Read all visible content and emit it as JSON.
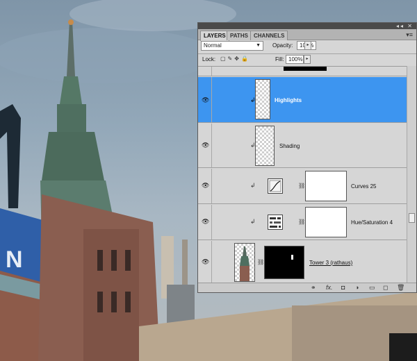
{
  "panel": {
    "tabs": [
      "LAYERS",
      "PATHS",
      "CHANNELS"
    ],
    "active_tab": "LAYERS",
    "blend_mode": "Normal",
    "opacity_label": "Opacity:",
    "opacity_value": "100%",
    "lock_label": "Lock:",
    "fill_label": "Fill:",
    "fill_value": "100%"
  },
  "layers": [
    {
      "name": "Highlights",
      "type": "pixel",
      "selected": true,
      "clipped": true
    },
    {
      "name": "Shading",
      "type": "pixel",
      "selected": false,
      "clipped": true
    },
    {
      "name": "Curves 25",
      "type": "adjustment-curves",
      "selected": false,
      "clipped": true,
      "mask": "white"
    },
    {
      "name": "Hue/Saturation 4",
      "type": "adjustment-hue-saturation",
      "selected": false,
      "clipped": true,
      "mask": "white"
    },
    {
      "name": "Tower 3 (rathaus)",
      "type": "pixel",
      "selected": false,
      "clipped": false,
      "mask": "black",
      "underlined": true
    }
  ],
  "colors": {
    "selection": "#3d95f0",
    "panel_bg": "#d6d6d6"
  },
  "icons": {
    "visibility": "eye-icon",
    "clip": "clipping-arrow-icon",
    "link": "chain-link-icon",
    "footer": [
      "link-layers-icon",
      "layer-style-fx-icon",
      "add-mask-icon",
      "adjustment-layer-icon",
      "new-group-icon",
      "new-layer-icon",
      "delete-layer-icon"
    ]
  },
  "footer_glyphs": {
    "link": "⚭",
    "fx": "fx.",
    "mask": "◘",
    "adjust": "◑",
    "group": "▭",
    "new": "◻",
    "delete": "🗑"
  }
}
